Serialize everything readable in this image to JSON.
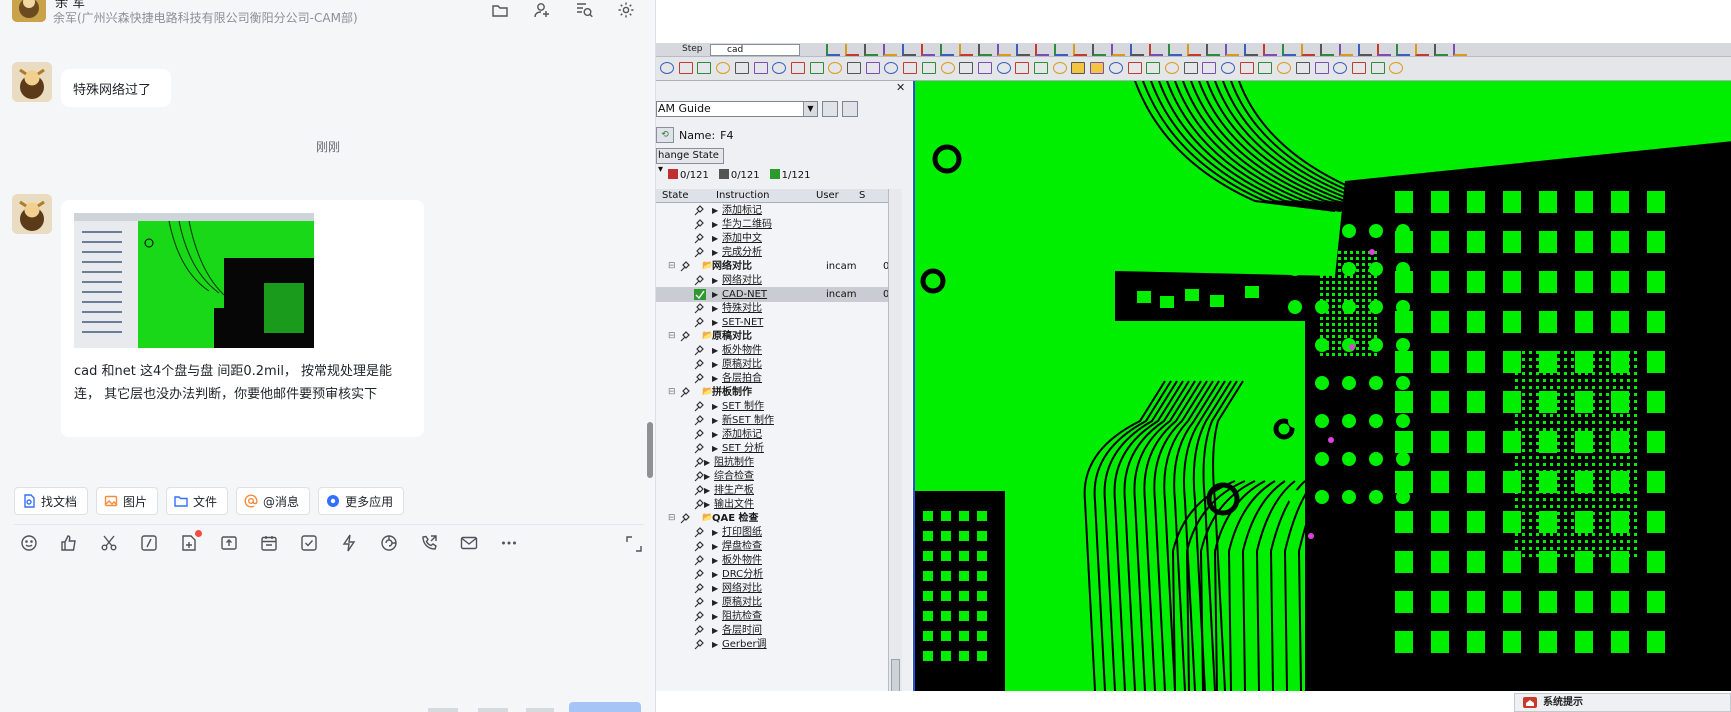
{
  "chat": {
    "header": {
      "name": "余 军",
      "org": "余军(广州兴森快捷电路科技有限公司衡阳分公司-CAM部)",
      "icons": [
        "folder-icon",
        "add-member-icon",
        "search-history-icon",
        "settings-icon"
      ]
    },
    "messages": [
      {
        "text": "特殊网络过了"
      },
      {
        "time": "刚刚"
      },
      {
        "text": " cad 和net 这4个盘与盘 间距0.2mil， 按常规处理是能连， 其它层也没办法判断，你要他邮件要预审核实下"
      }
    ],
    "quick_actions": [
      {
        "label": "找文档",
        "icon": "find-doc-icon",
        "color": "#3370ff"
      },
      {
        "label": "图片",
        "icon": "image-icon",
        "color": "#f78b3d"
      },
      {
        "label": "文件",
        "icon": "folder-icon",
        "color": "#3370ff"
      },
      {
        "label": "@消息",
        "icon": "at-icon",
        "color": "#f78b3d"
      },
      {
        "label": "更多应用",
        "icon": "apps-icon",
        "color": "#3370ff"
      }
    ],
    "toolbar_icons": [
      "emoji-icon",
      "thumbs-up-icon",
      "scissors-icon",
      "slash-command-icon",
      "new-doc-icon",
      "upload-icon",
      "calendar-icon",
      "task-check-icon",
      "lightning-icon",
      "screen-share-icon",
      "phone-icon",
      "mail-icon",
      "more-icon"
    ],
    "new_doc_badge": true
  },
  "cam": {
    "step_label": "Step",
    "step_value": "cad",
    "guide_title": "AM Guide",
    "name_label": "Name:",
    "name_value": "F4",
    "change_state": "hange State",
    "counts": [
      "0/121",
      "0/121",
      "1/121"
    ],
    "columns": [
      "State",
      "Instruction",
      "User",
      "S"
    ],
    "tree": [
      {
        "label": "添加标记",
        "type": "item"
      },
      {
        "label": "华为二维码",
        "type": "item"
      },
      {
        "label": "添加中文",
        "type": "item"
      },
      {
        "label": "完成分析",
        "type": "item"
      },
      {
        "label": "网络对比",
        "type": "group",
        "user": "incam",
        "s": "0-"
      },
      {
        "label": "网络对比",
        "type": "item"
      },
      {
        "label": "CAD-NET",
        "type": "item",
        "user": "incam",
        "s": "0-",
        "selected": true
      },
      {
        "label": "特殊对比",
        "type": "item"
      },
      {
        "label": "SET-NET",
        "type": "item"
      },
      {
        "label": "原稿对比",
        "type": "group"
      },
      {
        "label": "板外物件",
        "type": "item"
      },
      {
        "label": "原稿对比",
        "type": "item"
      },
      {
        "label": "各层拍合",
        "type": "item"
      },
      {
        "label": "拼板制作",
        "type": "group"
      },
      {
        "label": "SET 制作",
        "type": "item"
      },
      {
        "label": "新SET 制作",
        "type": "item"
      },
      {
        "label": "添加标记",
        "type": "item"
      },
      {
        "label": "SET 分析",
        "type": "item"
      },
      {
        "label": "阻抗制作",
        "type": "item0"
      },
      {
        "label": "综合检查",
        "type": "item0"
      },
      {
        "label": "排生产板",
        "type": "item0"
      },
      {
        "label": "输出文件",
        "type": "item0"
      },
      {
        "label": "QAE 检查",
        "type": "group"
      },
      {
        "label": "打印图纸",
        "type": "item"
      },
      {
        "label": "焊盘检查",
        "type": "item"
      },
      {
        "label": "板外物件",
        "type": "item"
      },
      {
        "label": "DRC分析",
        "type": "item"
      },
      {
        "label": "网络对比",
        "type": "item"
      },
      {
        "label": "原稿对比",
        "type": "item"
      },
      {
        "label": "阻抗检查",
        "type": "item"
      },
      {
        "label": "各层时间",
        "type": "item"
      },
      {
        "label": "Gerber调",
        "type": "item"
      }
    ],
    "system_tip": "系统提示",
    "colors": {
      "copper": "#00ee00",
      "background": "#000000",
      "marker": "#e040e0"
    }
  }
}
